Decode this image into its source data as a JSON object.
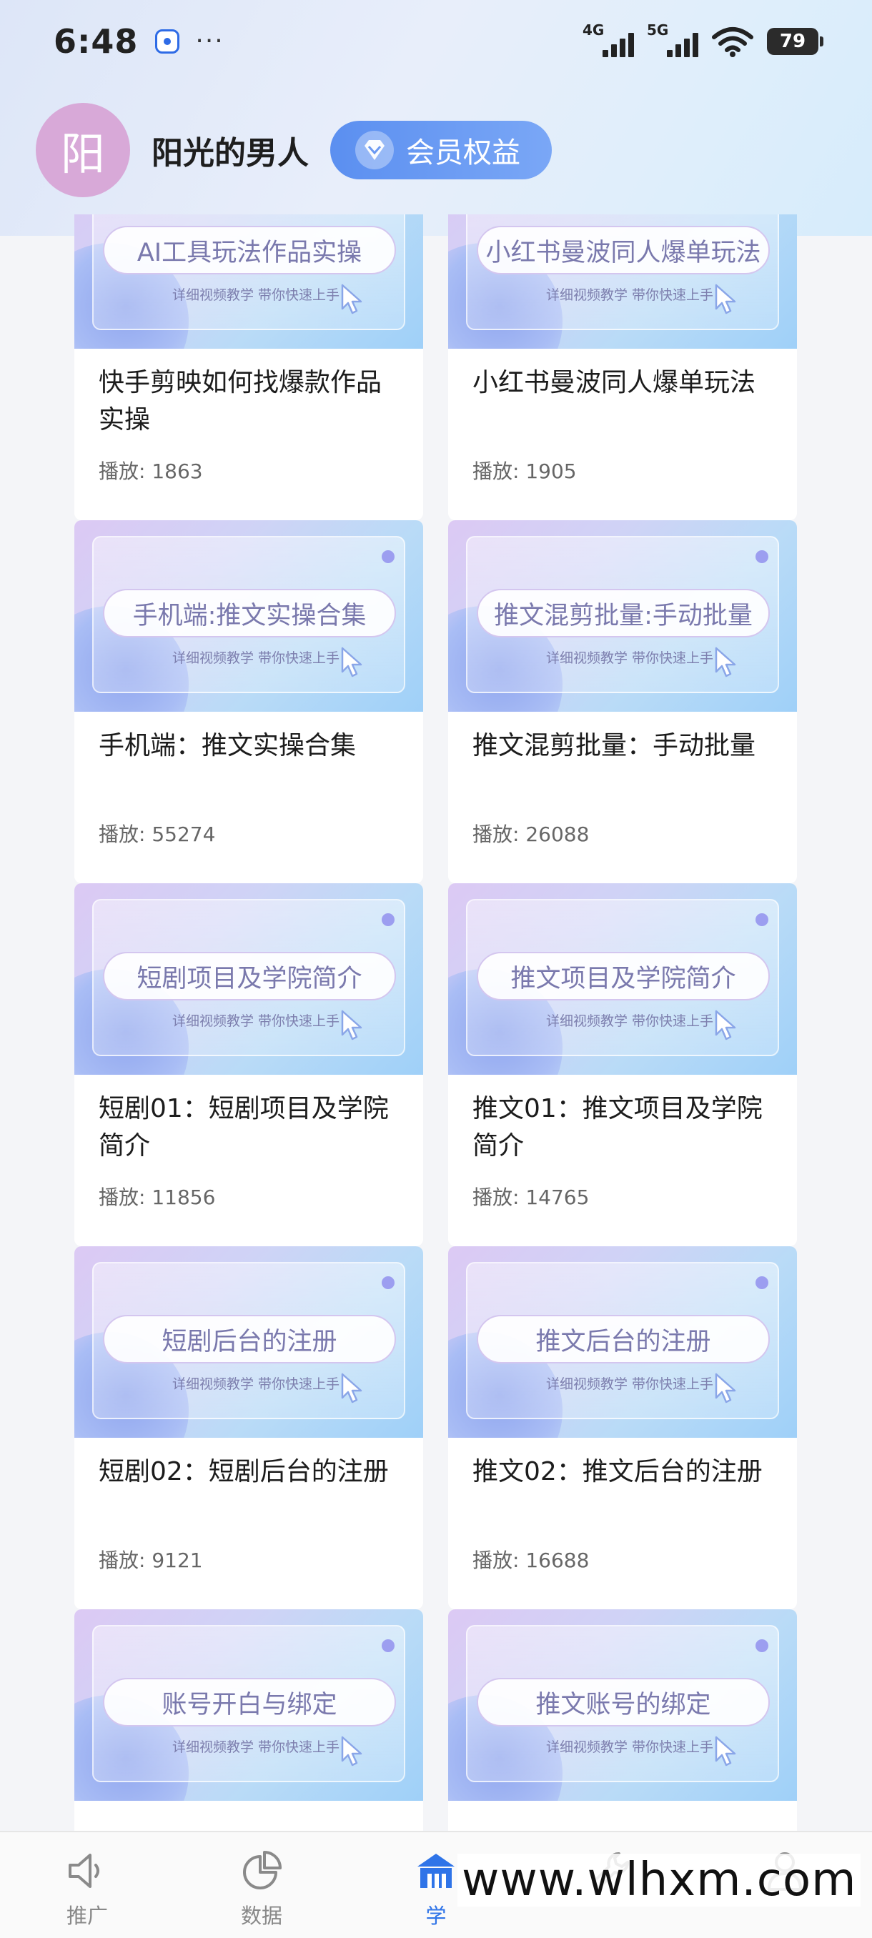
{
  "status_bar": {
    "time": "6:48",
    "dots": "···",
    "network_1": "4G",
    "network_2": "5G",
    "battery": "79",
    "app_icon": "baidu-paw-icon"
  },
  "header": {
    "avatar_text": "阳",
    "user_name": "阳光的男人",
    "member_button": "会员权益",
    "member_icon": "diamond-icon"
  },
  "thumb_subtitle": "详细视频教学 带你快速上手",
  "play_prefix": "播放: ",
  "videos": [
    {
      "thumb_title": "AI工具玩法作品实操",
      "title": "快手剪映如何找爆款作品实操",
      "plays": "1863"
    },
    {
      "thumb_title": "小红书曼波同人爆单玩法",
      "title": "小红书曼波同人爆单玩法",
      "plays": "1905"
    },
    {
      "thumb_title": "手机端:推文实操合集",
      "title": "手机端：推文实操合集",
      "plays": "55274"
    },
    {
      "thumb_title": "推文混剪批量:手动批量",
      "title": "推文混剪批量：手动批量",
      "plays": "26088"
    },
    {
      "thumb_title": "短剧项目及学院简介",
      "title": "短剧01：短剧项目及学院简介",
      "plays": "11856"
    },
    {
      "thumb_title": "推文项目及学院简介",
      "title": "推文01：推文项目及学院简介",
      "plays": "14765"
    },
    {
      "thumb_title": "短剧后台的注册",
      "title": "短剧02：短剧后台的注册",
      "plays": "9121"
    },
    {
      "thumb_title": "推文后台的注册",
      "title": "推文02：推文后台的注册",
      "plays": "16688"
    },
    {
      "thumb_title": "账号开白与绑定",
      "title": "",
      "plays": ""
    },
    {
      "thumb_title": "推文账号的绑定",
      "title": "",
      "plays": ""
    }
  ],
  "bottom_nav": [
    {
      "label": "推广",
      "icon": "speaker-icon",
      "active": false
    },
    {
      "label": "数据",
      "icon": "pie-chart-icon",
      "active": false
    },
    {
      "label": "学",
      "icon": "school-icon",
      "active": true
    },
    {
      "label": "",
      "icon": "wrench-icon",
      "active": false
    },
    {
      "label": "",
      "icon": "user-icon",
      "active": false
    }
  ],
  "watermark": "www.wlhxm.com",
  "colors": {
    "accent": "#2f74e8",
    "member_button": "#5b8ff0",
    "avatar": "#d8a9d8",
    "thumb_text": "#7a79ad"
  }
}
